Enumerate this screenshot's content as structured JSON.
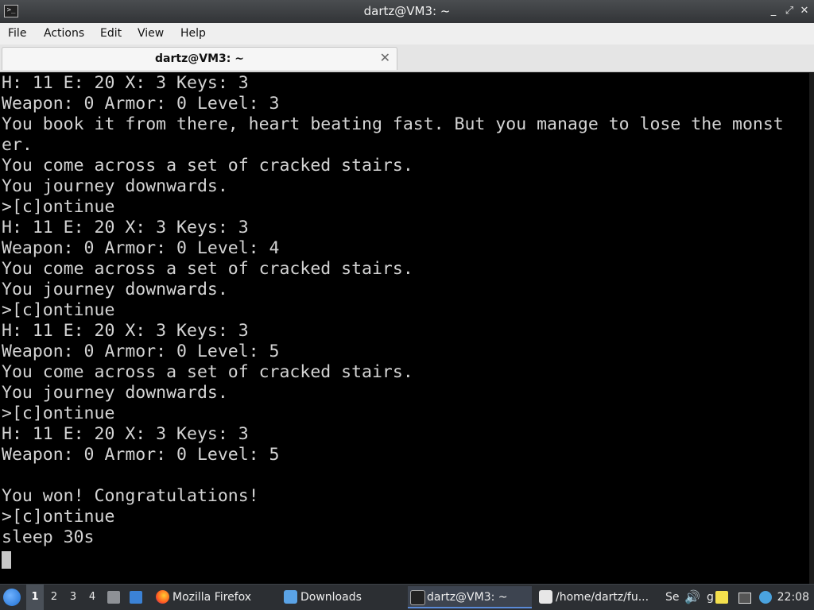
{
  "window": {
    "title": "dartz@VM3: ~",
    "controls": [
      "_",
      "⤢",
      "✕"
    ]
  },
  "menu": {
    "items": [
      "File",
      "Actions",
      "Edit",
      "View",
      "Help"
    ]
  },
  "tab": {
    "label": "dartz@VM3: ~",
    "close": "✕"
  },
  "terminal": {
    "lines": [
      "H: 11 E: 20 X: 3 Keys: 3",
      "Weapon: 0 Armor: 0 Level: 3",
      "You book it from there, heart beating fast. But you manage to lose the monst",
      "er.",
      "You come across a set of cracked stairs.",
      "You journey downwards.",
      ">[c]ontinue",
      "H: 11 E: 20 X: 3 Keys: 3",
      "Weapon: 0 Armor: 0 Level: 4",
      "You come across a set of cracked stairs.",
      "You journey downwards.",
      ">[c]ontinue",
      "H: 11 E: 20 X: 3 Keys: 3",
      "Weapon: 0 Armor: 0 Level: 5",
      "You come across a set of cracked stairs.",
      "You journey downwards.",
      ">[c]ontinue",
      "H: 11 E: 20 X: 3 Keys: 3",
      "Weapon: 0 Armor: 0 Level: 5",
      "",
      "You won! Congratulations!",
      ">[c]ontinue",
      "sleep 30s"
    ]
  },
  "taskbar": {
    "desktops": [
      "1",
      "2",
      "3",
      "4"
    ],
    "tasks": [
      {
        "label": "Mozilla Firefox",
        "icon": "firefox-icon"
      },
      {
        "label": "Downloads",
        "icon": "folder-icon"
      },
      {
        "label": "dartz@VM3: ~",
        "icon": "terminal-icon"
      },
      {
        "label": "/home/dartz/fu...",
        "icon": "document-icon"
      }
    ],
    "tray_text_1": "Se",
    "tray_text_2": "g",
    "clock": "22:08"
  }
}
